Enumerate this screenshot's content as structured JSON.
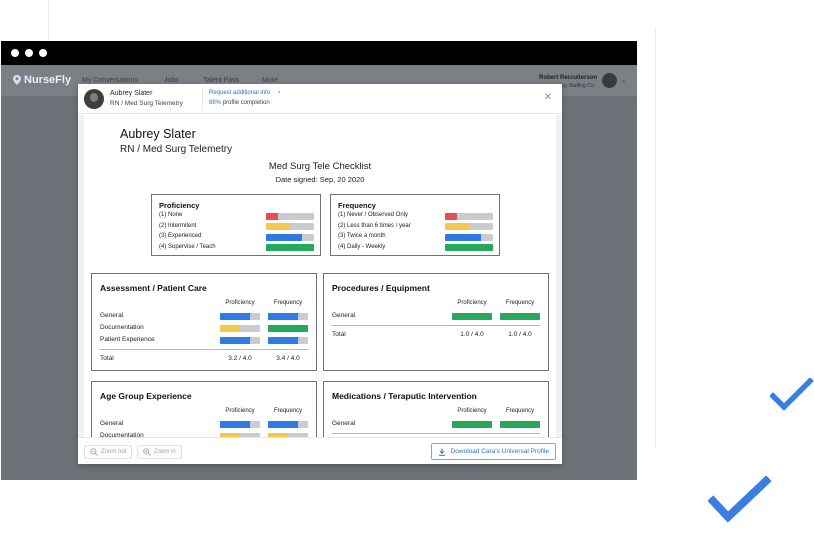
{
  "app": {
    "logo_text": "NurseFly",
    "nav": [
      "My Conversations",
      "Jobs",
      "Talent Pass",
      "More"
    ],
    "recruiter_name": "Robert Recruiterson",
    "recruiter_company": "Jay Staffing Co."
  },
  "modal": {
    "candidate_name": "Aubrey Slater",
    "candidate_role": "RN / Med Surg Telemetry",
    "request_link": "Request additional info",
    "completion_pct": "88%",
    "completion_text": "profile completion",
    "close_icon": "close-icon"
  },
  "document": {
    "name": "Aubrey Slater",
    "role": "RN / Med Surg Telemetry",
    "checklist_title": "Med Surg Tele Checklist",
    "date_signed": "Date signed: Sep, 20 2020",
    "proficiency_legend": {
      "title": "Proficiency",
      "items": [
        {
          "label": "(1) None",
          "level": 0.25,
          "color": "#e25050"
        },
        {
          "label": "(2) Intermitent",
          "level": 0.5,
          "color": "#f2c94c"
        },
        {
          "label": "(3) Experienced",
          "level": 0.75,
          "color": "#2f7be4"
        },
        {
          "label": "(4) Supervise / Teach",
          "level": 1.0,
          "color": "#24a85a"
        }
      ]
    },
    "frequency_legend": {
      "title": "Frequency",
      "items": [
        {
          "label": "(1) Never / Observed Only",
          "level": 0.25,
          "color": "#e25050"
        },
        {
          "label": "(2) Less than 6 times  / year",
          "level": 0.5,
          "color": "#f2c94c"
        },
        {
          "label": "(3) Twice a month",
          "level": 0.75,
          "color": "#2f7be4"
        },
        {
          "label": "(4) Daily - Weekly",
          "level": 1.0,
          "color": "#24a85a"
        }
      ]
    },
    "col_proficiency": "Proficiency",
    "col_frequency": "Frequency",
    "total_label": "Total",
    "sections": [
      {
        "title": "Assessment / Patient Care",
        "rows": [
          {
            "label": "General",
            "proficiency": 3,
            "frequency": 3
          },
          {
            "label": "Documentation",
            "proficiency": 2,
            "frequency": 4
          },
          {
            "label": "Patient Experience",
            "proficiency": 3,
            "frequency": 3
          }
        ],
        "total_proficiency": "3.2 / 4.0",
        "total_frequency": "3.4 / 4.0"
      },
      {
        "title": "Procedures / Equipment",
        "rows": [
          {
            "label": "General",
            "proficiency": 4,
            "frequency": 4
          }
        ],
        "total_proficiency": "1.0 / 4.0",
        "total_frequency": "1.0 / 4.0"
      },
      {
        "title": "Age Group Experience",
        "rows": [
          {
            "label": "General",
            "proficiency": 3,
            "frequency": 3
          },
          {
            "label": "Documentation",
            "proficiency": 2,
            "frequency": 2
          }
        ]
      },
      {
        "title": "Medications / Teraputic Intervention",
        "rows": [
          {
            "label": "General",
            "proficiency": 4,
            "frequency": 4
          }
        ]
      }
    ]
  },
  "footer": {
    "zoom_out": "Zoom out",
    "zoom_in": "Zoom in",
    "download": "Download Cara's Universal Profile"
  },
  "colors": {
    "level_1": "#e25050",
    "level_2": "#f2c94c",
    "level_3": "#2f7be4",
    "level_4": "#24a85a",
    "track": "#c9cbce",
    "accent": "#2f6fd6",
    "check": "#3b7de0"
  }
}
